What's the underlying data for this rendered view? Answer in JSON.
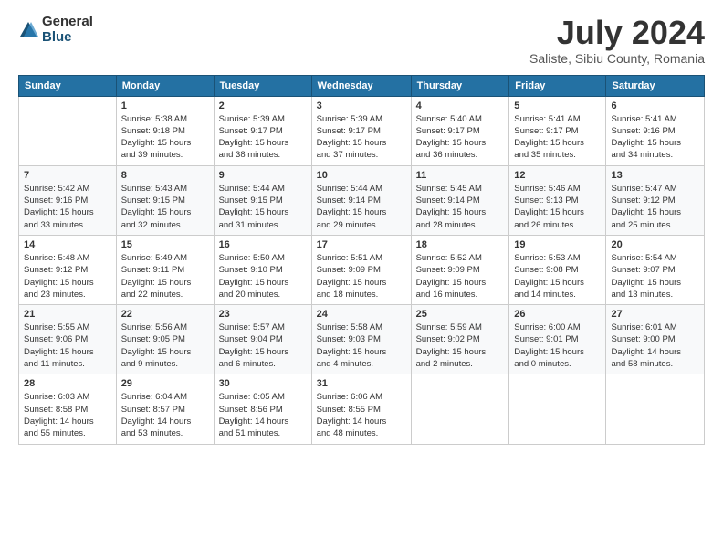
{
  "header": {
    "logo_general": "General",
    "logo_blue": "Blue",
    "month_title": "July 2024",
    "location": "Saliste, Sibiu County, Romania"
  },
  "weekdays": [
    "Sunday",
    "Monday",
    "Tuesday",
    "Wednesday",
    "Thursday",
    "Friday",
    "Saturday"
  ],
  "weeks": [
    [
      {
        "day": "",
        "info": ""
      },
      {
        "day": "1",
        "info": "Sunrise: 5:38 AM\nSunset: 9:18 PM\nDaylight: 15 hours\nand 39 minutes."
      },
      {
        "day": "2",
        "info": "Sunrise: 5:39 AM\nSunset: 9:17 PM\nDaylight: 15 hours\nand 38 minutes."
      },
      {
        "day": "3",
        "info": "Sunrise: 5:39 AM\nSunset: 9:17 PM\nDaylight: 15 hours\nand 37 minutes."
      },
      {
        "day": "4",
        "info": "Sunrise: 5:40 AM\nSunset: 9:17 PM\nDaylight: 15 hours\nand 36 minutes."
      },
      {
        "day": "5",
        "info": "Sunrise: 5:41 AM\nSunset: 9:17 PM\nDaylight: 15 hours\nand 35 minutes."
      },
      {
        "day": "6",
        "info": "Sunrise: 5:41 AM\nSunset: 9:16 PM\nDaylight: 15 hours\nand 34 minutes."
      }
    ],
    [
      {
        "day": "7",
        "info": "Sunrise: 5:42 AM\nSunset: 9:16 PM\nDaylight: 15 hours\nand 33 minutes."
      },
      {
        "day": "8",
        "info": "Sunrise: 5:43 AM\nSunset: 9:15 PM\nDaylight: 15 hours\nand 32 minutes."
      },
      {
        "day": "9",
        "info": "Sunrise: 5:44 AM\nSunset: 9:15 PM\nDaylight: 15 hours\nand 31 minutes."
      },
      {
        "day": "10",
        "info": "Sunrise: 5:44 AM\nSunset: 9:14 PM\nDaylight: 15 hours\nand 29 minutes."
      },
      {
        "day": "11",
        "info": "Sunrise: 5:45 AM\nSunset: 9:14 PM\nDaylight: 15 hours\nand 28 minutes."
      },
      {
        "day": "12",
        "info": "Sunrise: 5:46 AM\nSunset: 9:13 PM\nDaylight: 15 hours\nand 26 minutes."
      },
      {
        "day": "13",
        "info": "Sunrise: 5:47 AM\nSunset: 9:12 PM\nDaylight: 15 hours\nand 25 minutes."
      }
    ],
    [
      {
        "day": "14",
        "info": "Sunrise: 5:48 AM\nSunset: 9:12 PM\nDaylight: 15 hours\nand 23 minutes."
      },
      {
        "day": "15",
        "info": "Sunrise: 5:49 AM\nSunset: 9:11 PM\nDaylight: 15 hours\nand 22 minutes."
      },
      {
        "day": "16",
        "info": "Sunrise: 5:50 AM\nSunset: 9:10 PM\nDaylight: 15 hours\nand 20 minutes."
      },
      {
        "day": "17",
        "info": "Sunrise: 5:51 AM\nSunset: 9:09 PM\nDaylight: 15 hours\nand 18 minutes."
      },
      {
        "day": "18",
        "info": "Sunrise: 5:52 AM\nSunset: 9:09 PM\nDaylight: 15 hours\nand 16 minutes."
      },
      {
        "day": "19",
        "info": "Sunrise: 5:53 AM\nSunset: 9:08 PM\nDaylight: 15 hours\nand 14 minutes."
      },
      {
        "day": "20",
        "info": "Sunrise: 5:54 AM\nSunset: 9:07 PM\nDaylight: 15 hours\nand 13 minutes."
      }
    ],
    [
      {
        "day": "21",
        "info": "Sunrise: 5:55 AM\nSunset: 9:06 PM\nDaylight: 15 hours\nand 11 minutes."
      },
      {
        "day": "22",
        "info": "Sunrise: 5:56 AM\nSunset: 9:05 PM\nDaylight: 15 hours\nand 9 minutes."
      },
      {
        "day": "23",
        "info": "Sunrise: 5:57 AM\nSunset: 9:04 PM\nDaylight: 15 hours\nand 6 minutes."
      },
      {
        "day": "24",
        "info": "Sunrise: 5:58 AM\nSunset: 9:03 PM\nDaylight: 15 hours\nand 4 minutes."
      },
      {
        "day": "25",
        "info": "Sunrise: 5:59 AM\nSunset: 9:02 PM\nDaylight: 15 hours\nand 2 minutes."
      },
      {
        "day": "26",
        "info": "Sunrise: 6:00 AM\nSunset: 9:01 PM\nDaylight: 15 hours\nand 0 minutes."
      },
      {
        "day": "27",
        "info": "Sunrise: 6:01 AM\nSunset: 9:00 PM\nDaylight: 14 hours\nand 58 minutes."
      }
    ],
    [
      {
        "day": "28",
        "info": "Sunrise: 6:03 AM\nSunset: 8:58 PM\nDaylight: 14 hours\nand 55 minutes."
      },
      {
        "day": "29",
        "info": "Sunrise: 6:04 AM\nSunset: 8:57 PM\nDaylight: 14 hours\nand 53 minutes."
      },
      {
        "day": "30",
        "info": "Sunrise: 6:05 AM\nSunset: 8:56 PM\nDaylight: 14 hours\nand 51 minutes."
      },
      {
        "day": "31",
        "info": "Sunrise: 6:06 AM\nSunset: 8:55 PM\nDaylight: 14 hours\nand 48 minutes."
      },
      {
        "day": "",
        "info": ""
      },
      {
        "day": "",
        "info": ""
      },
      {
        "day": "",
        "info": ""
      }
    ]
  ]
}
